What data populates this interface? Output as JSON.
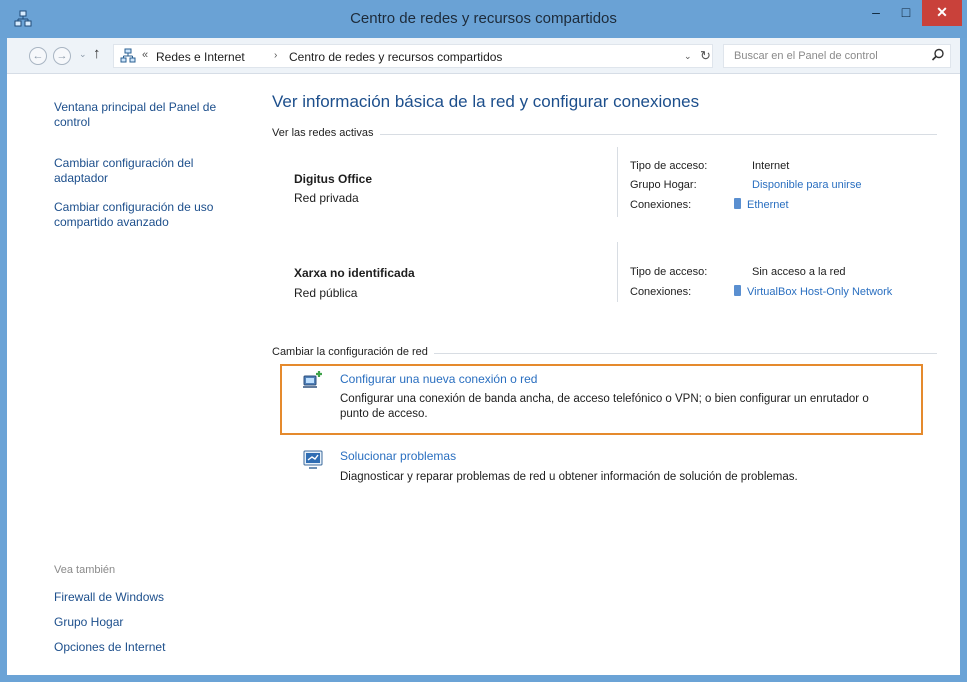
{
  "window": {
    "title": "Centro de redes y recursos compartidos",
    "min_glyph": "–",
    "max_glyph": "□",
    "close_glyph": "✕"
  },
  "addressbar": {
    "back_glyph": "←",
    "forward_glyph": "→",
    "up_glyph": "↑",
    "overflow_glyph": "«",
    "crumbs": [
      "Redes e Internet",
      "Centro de redes y recursos compartidos"
    ],
    "crumb_separator": "›",
    "dropdown_glyph": "⌄",
    "refresh_glyph": "↻",
    "search_placeholder": "Buscar en el Panel de control"
  },
  "sidebar": {
    "links": [
      "Ventana principal del Panel de control",
      "Cambiar configuración del adaptador",
      "Cambiar configuración de uso compartido avanzado"
    ],
    "see_also_label": "Vea también",
    "see_also_links": [
      "Firewall de Windows",
      "Grupo Hogar",
      "Opciones de Internet"
    ]
  },
  "main": {
    "title": "Ver información básica de la red y configurar conexiones",
    "active_networks_label": "Ver las redes activas",
    "networks": [
      {
        "name": "Digitus Office",
        "type": "Red privada",
        "access_type_key": "Tipo de acceso:",
        "access_type_value": "Internet",
        "homegroup_key": "Grupo Hogar:",
        "homegroup_value": "Disponible para unirse",
        "connections_key": "Conexiones:",
        "connection_value": "Ethernet"
      },
      {
        "name": "Xarxa no identificada",
        "type": "Red pública",
        "access_type_key": "Tipo de acceso:",
        "access_type_value": "Sin acceso a la red",
        "connections_key": "Conexiones:",
        "connection_value": "VirtualBox Host-Only Network"
      }
    ],
    "change_settings_label": "Cambiar la configuración de red",
    "tasks": [
      {
        "link": "Configurar una nueva conexión o red",
        "description": "Configurar una conexión de banda ancha, de acceso telefónico o VPN; o bien configurar un enrutador o punto de acceso."
      },
      {
        "link": "Solucionar problemas",
        "description": "Diagnosticar y reparar problemas de red u obtener información de solución de problemas."
      }
    ]
  },
  "colors": {
    "titlebar": "#6aa2d5",
    "link": "#1d4f8c",
    "highlight": "#e58a2d",
    "close": "#c9413a"
  }
}
